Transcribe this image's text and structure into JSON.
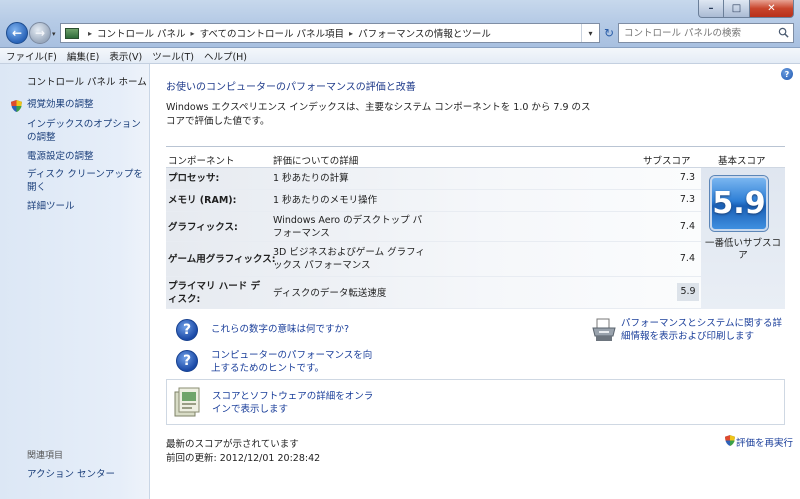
{
  "window": {
    "minimize_glyph": "–",
    "maximize_glyph": "□",
    "close_glyph": "✕"
  },
  "nav": {
    "back_glyph": "←",
    "forward_glyph": "→",
    "dropdown_glyph": "▾"
  },
  "address": {
    "segments": [
      "コントロール パネル",
      "すべてのコントロール パネル項目",
      "パフォーマンスの情報とツール"
    ],
    "separator": "▸",
    "dropdown_glyph": "▾",
    "refresh_glyph": "↻"
  },
  "search": {
    "placeholder": "コントロール パネルの検索"
  },
  "menu": [
    "ファイル(F)",
    "編集(E)",
    "表示(V)",
    "ツール(T)",
    "ヘルプ(H)"
  ],
  "sidebar": {
    "home": "コントロール パネル ホーム",
    "links": [
      "視覚効果の調整",
      "インデックスのオプションの調整",
      "電源設定の調整",
      "ディスク クリーンアップを開く",
      "詳細ツール"
    ],
    "related_header": "関連項目",
    "action_center": "アクション センター"
  },
  "main": {
    "help_glyph": "?",
    "title": "お使いのコンピューターのパフォーマンスの評価と改善",
    "description": "Windows エクスペリエンス インデックスは、主要なシステム コンポーネントを 1.0 から 7.9 のスコアで評価した値です。",
    "table": {
      "headers": {
        "component": "コンポーネント",
        "details": "評価についての詳細",
        "subscore": "サブスコア",
        "basescore": "基本スコア"
      },
      "rows": [
        {
          "name": "プロセッサ:",
          "detail": "1 秒あたりの計算",
          "score": "7.3"
        },
        {
          "name": "メモリ (RAM):",
          "detail": "1 秒あたりのメモリ操作",
          "score": "7.3"
        },
        {
          "name": "グラフィックス:",
          "detail": "Windows Aero のデスクトップ パフォーマンス",
          "score": "7.4"
        },
        {
          "name": "ゲーム用グラフィックス:",
          "detail": "3D ビジネスおよびゲーム グラフィックス パフォーマンス",
          "score": "7.4"
        },
        {
          "name": "プライマリ ハード ディスク:",
          "detail": "ディスクのデータ転送速度",
          "score": "5.9"
        }
      ],
      "base_score": "5.9",
      "base_label": "一番低いサブスコア"
    },
    "help_links": {
      "meaning": "これらの数字の意味は何ですか?",
      "tips": "コンピューターのパフォーマンスを向上するためのヒントです。",
      "print": "パフォーマンスとシステムに関する詳細情報を表示および印刷します"
    },
    "online": "スコアとソフトウェアの詳細をオンラインで表示します",
    "latest": "最新のスコアが示されています",
    "updated": "前回の更新: 2012/12/01 20:28:42",
    "rerun": "評価を再実行"
  }
}
